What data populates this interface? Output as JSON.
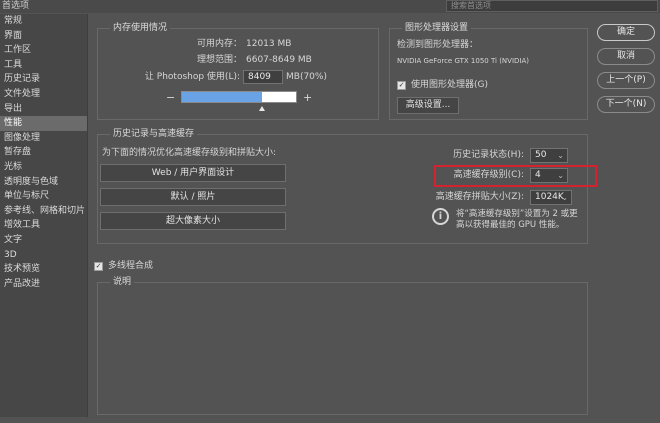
{
  "window": {
    "title": "首选项",
    "search_placeholder": "搜索首选项"
  },
  "sidebar": {
    "items": [
      {
        "label": "常规"
      },
      {
        "label": "界面"
      },
      {
        "label": "工作区"
      },
      {
        "label": "工具"
      },
      {
        "label": "历史记录"
      },
      {
        "label": "文件处理"
      },
      {
        "label": "导出"
      },
      {
        "label": "性能",
        "active": true
      },
      {
        "label": "图像处理"
      },
      {
        "label": "暂存盘"
      },
      {
        "label": "光标"
      },
      {
        "label": "透明度与色域"
      },
      {
        "label": "单位与标尺"
      },
      {
        "label": "参考线、网格和切片"
      },
      {
        "label": "增效工具"
      },
      {
        "label": "文字"
      },
      {
        "label": "3D"
      },
      {
        "label": "技术预览"
      },
      {
        "label": "产品改进"
      }
    ]
  },
  "memory": {
    "legend": "内存使用情况",
    "available_label": "可用内存：",
    "available_value": "12013 MB",
    "ideal_label": "理想范围：",
    "ideal_value": "6607-8649 MB",
    "use_label": "让 Photoshop 使用(L):",
    "use_value": "8409",
    "use_unit": "MB(70%)",
    "minus": "−",
    "plus": "+",
    "slider_fraction": 0.7
  },
  "gpu": {
    "legend": "图形处理器设置",
    "detected_label": "检测到图形处理器：",
    "card_name": "NVIDIA GeForce GTX 1050 Ti (NVIDIA)",
    "use_gpu_label": "使用图形处理器(G)",
    "use_gpu_checked": true,
    "advanced_button": "高级设置..."
  },
  "history_cache": {
    "legend": "历史记录与高速缓存",
    "optimize_label": "为下面的情况优化高速缓存级别和拼贴大小:",
    "buttons": [
      "Web / 用户界面设计",
      "默认 / 照片",
      "超大像素大小"
    ],
    "history_states_label": "历史记录状态(H):",
    "history_states_value": "50",
    "cache_levels_label": "高速缓存级别(C):",
    "cache_levels_value": "4",
    "tile_size_label": "高速缓存拼贴大小(Z):",
    "tile_size_value": "1024K",
    "info_line1": "将“高速缓存级别”设置为 2 或更",
    "info_line2": "高以获得最佳的 GPU 性能。"
  },
  "multithread": {
    "label": "多线程合成",
    "checked": true
  },
  "description": {
    "legend": "说明"
  },
  "actions": {
    "ok": "确定",
    "cancel": "取消",
    "prev": "上一个(P)",
    "next": "下一个(N)"
  },
  "icons": {
    "checkbox": "checkmark-icon",
    "info": "info-icon",
    "dropdown": "chevron-down-icon"
  }
}
